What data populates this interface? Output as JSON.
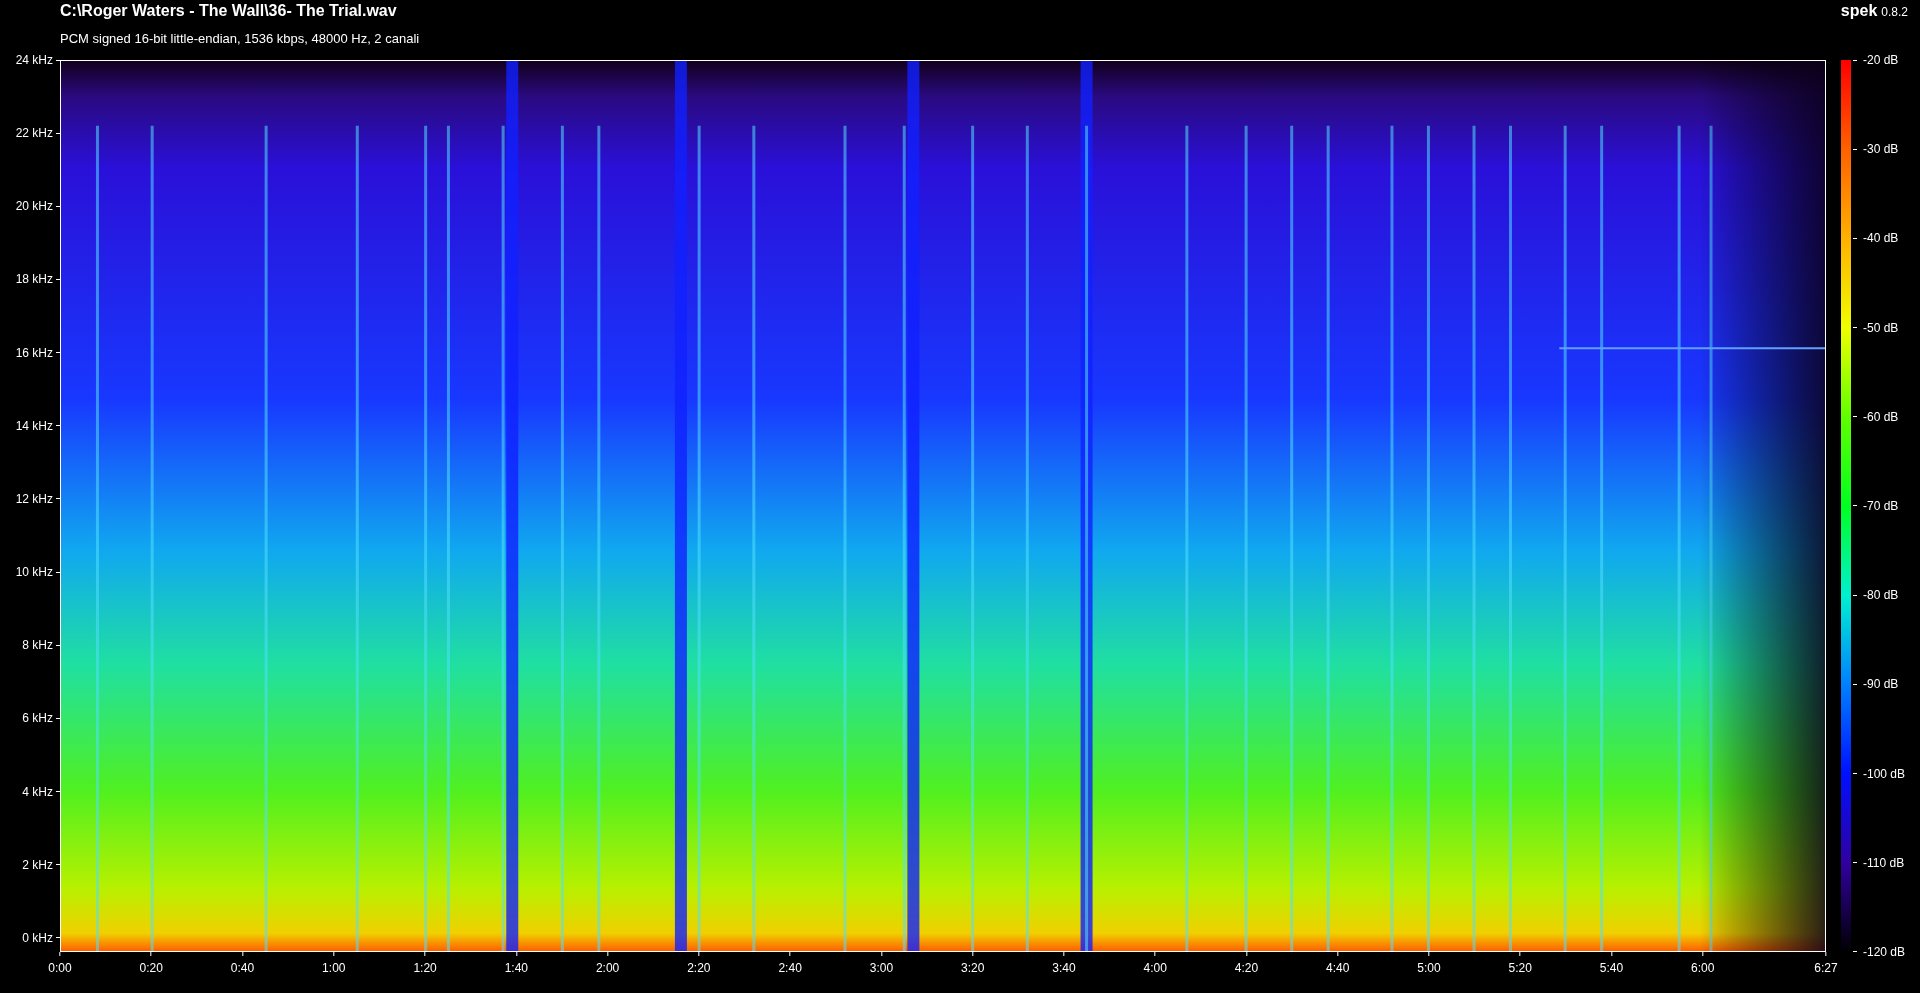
{
  "file_title": "C:\\Roger Waters - The Wall\\36- The Trial.wav",
  "app": {
    "name": "spek",
    "version": "0.8.2"
  },
  "stream_info": "PCM signed 16-bit little-endian, 1536 kbps, 48000 Hz, 2 canali",
  "frequency_axis": {
    "ticks": [
      "24 kHz",
      "22 kHz",
      "20 kHz",
      "18 kHz",
      "16 kHz",
      "14 kHz",
      "12 kHz",
      "10 kHz",
      "8 kHz",
      "6 kHz",
      "4 kHz",
      "2 kHz",
      "0 kHz"
    ]
  },
  "time_axis": {
    "ticks": [
      "0:00",
      "0:20",
      "0:40",
      "1:00",
      "1:20",
      "1:40",
      "2:00",
      "2:20",
      "2:40",
      "3:00",
      "3:20",
      "3:40",
      "4:00",
      "4:20",
      "4:40",
      "5:00",
      "5:20",
      "5:40",
      "6:00",
      "6:27"
    ]
  },
  "db_scale": {
    "ticks": [
      "-20 dB",
      "-30 dB",
      "-40 dB",
      "-50 dB",
      "-60 dB",
      "-70 dB",
      "-80 dB",
      "-90 dB",
      "-100 dB",
      "-110 dB",
      "-120 dB"
    ]
  }
}
